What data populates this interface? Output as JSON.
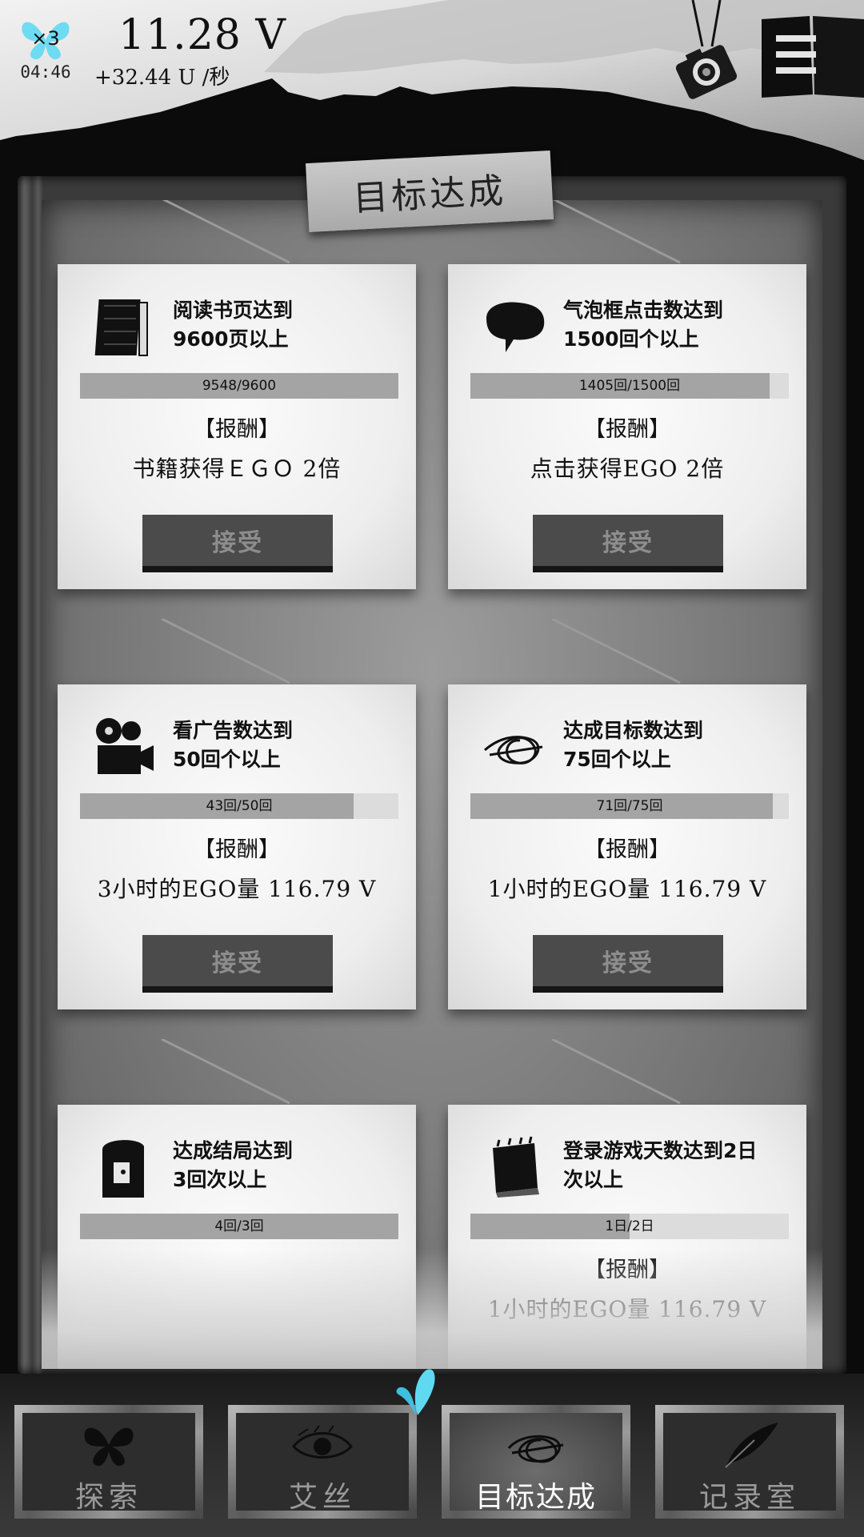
{
  "header": {
    "multiplier": "×3",
    "timer": "04:46",
    "energy": "11.28 V",
    "rate": "+32.44 U /秒",
    "accent_color": "#5fd9f2"
  },
  "page_title": "目标达成",
  "cards": [
    {
      "icon": "book-stack-icon",
      "goal_line1": "阅读书页达到",
      "goal_line2": "9600页以上",
      "progress_text": "9548/9600",
      "progress_fraction": 1.0,
      "reward_label": "【报酬】",
      "reward": "书籍获得ＥＧＯ 2倍",
      "accept": "接受"
    },
    {
      "icon": "speech-bubble-icon",
      "goal_line1": "气泡框点击数达到",
      "goal_line2": "1500回个以上",
      "progress_text": "1405回/1500回",
      "progress_fraction": 0.94,
      "reward_label": "【报酬】",
      "reward": "点击获得EGO 2倍",
      "accept": "接受"
    },
    {
      "icon": "film-projector-icon",
      "goal_line1": "看广告数达到",
      "goal_line2": "50回个以上",
      "progress_text": "43回/50回",
      "progress_fraction": 0.86,
      "reward_label": "【报酬】",
      "reward": "3小时的EGO量 116.79 V",
      "accept": "接受"
    },
    {
      "icon": "scribble-goal-icon",
      "goal_line1": "达成目标数达到",
      "goal_line2": "75回个以上",
      "progress_text": "71回/75回",
      "progress_fraction": 0.95,
      "reward_label": "【报酬】",
      "reward": "1小时的EGO量 116.79 V",
      "accept": "接受"
    },
    {
      "icon": "door-icon",
      "goal_line1": "达成结局达到",
      "goal_line2": "3回次以上",
      "progress_text": "4回/3回",
      "progress_fraction": 1.0,
      "reward_label": "",
      "reward": "",
      "accept": ""
    },
    {
      "icon": "calendar-icon",
      "goal_line1": "登录游戏天数达到2日",
      "goal_line2": "次以上",
      "progress_text": "1日/2日",
      "progress_fraction": 0.5,
      "reward_label": "【报酬】",
      "reward": "1小时的EGO量 116.79 V",
      "accept": ""
    }
  ],
  "nav": [
    {
      "label": "探索",
      "icon": "butterfly-icon",
      "active": false
    },
    {
      "label": "艾丝",
      "icon": "eye-icon",
      "active": false
    },
    {
      "label": "目标达成",
      "icon": "scribble-icon",
      "active": true
    },
    {
      "label": "记录室",
      "icon": "feather-quill-icon",
      "active": false
    }
  ]
}
